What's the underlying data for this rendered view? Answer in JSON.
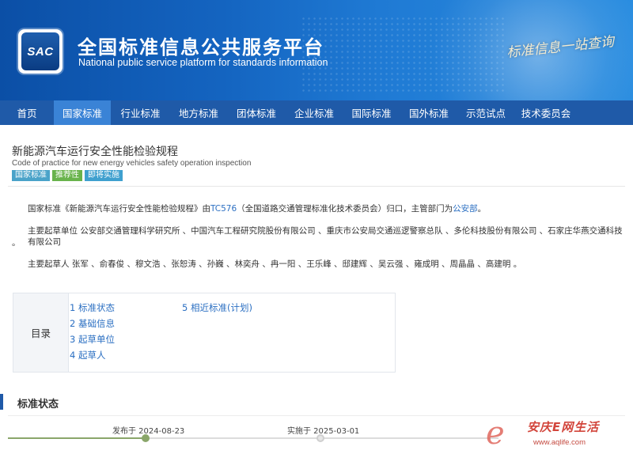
{
  "header": {
    "logo_text": "SAC",
    "title": "全国标准信息公共服务平台",
    "subtitle": "National public service platform  for standards information",
    "slogan": "标准信息一站查询"
  },
  "nav": {
    "items": [
      "首页",
      "国家标准",
      "行业标准",
      "地方标准",
      "团体标准",
      "企业标准",
      "国际标准",
      "国外标准",
      "示范试点",
      "技术委员会"
    ],
    "active_index": 1
  },
  "standard": {
    "title": "新能源汽车运行安全性能检验规程",
    "title_en": "Code of practice for new energy vehicles safety operation inspection",
    "badges": [
      {
        "label": "国家标准",
        "color": "#4aa3c9"
      },
      {
        "label": "推荐性",
        "color": "#69b34c"
      },
      {
        "label": "即将实施",
        "color": "#3fa0cf"
      }
    ]
  },
  "description": {
    "line1_a": "国家标准《新能源汽车运行安全性能检验规程》由",
    "line1_tc": "TC576",
    "line1_b": "（全国道路交通管理标准化技术委员会）归口，主管部门为",
    "line1_dept": "公安部",
    "line1_c": "。",
    "units": "主要起草单位 公安部交通管理科学研究所 、中国汽车工程研究院股份有限公司 、重庆市公安局交通巡逻警察总队 、多伦科技股份有限公司 、石家庄华燕交通科技有限公司",
    "units_tail": "。",
    "drafters": "主要起草人 张军 、俞春俊 、穆文浩 、张恕涛 、孙巍 、林奕舟 、冉一阳 、王乐峰 、邸建辉 、吴云强 、雍成明 、周晶晶 、高建明 。"
  },
  "toc": {
    "label": "目录",
    "items": [
      "1  标准状态",
      "2  基础信息",
      "3  起草单位",
      "4  起草人",
      "5  相近标准(计划)"
    ]
  },
  "status_section": {
    "title": "标准状态",
    "published_label": "发布于 2024-08-23",
    "implemented_label": "实施于 2025-03-01",
    "colors": {
      "done": "#8aa66a",
      "pending": "#cfcfcf"
    }
  },
  "watermark": {
    "mark": "e",
    "text": "安庆E网生活",
    "url": "www.aqlife.com"
  }
}
